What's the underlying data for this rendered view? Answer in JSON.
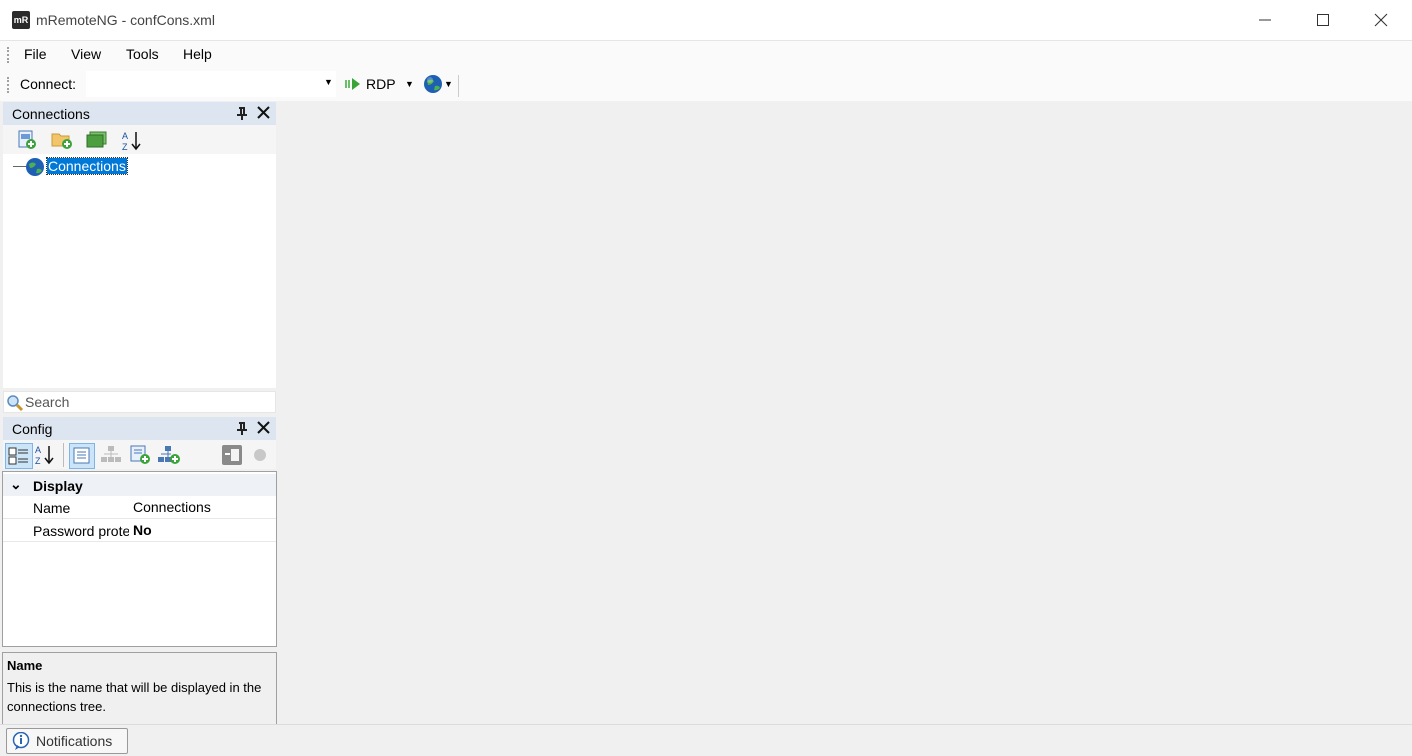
{
  "window": {
    "logo_text": "mR",
    "title": "mRemoteNG - confCons.xml",
    "minimize_glyph": "—",
    "maximize_glyph": "☐",
    "close_glyph": "✕"
  },
  "menu": {
    "items": [
      {
        "label": "File"
      },
      {
        "label": "View"
      },
      {
        "label": "Tools"
      },
      {
        "label": "Help"
      }
    ]
  },
  "toolbar": {
    "connect_label": "Connect:",
    "connect_value": "",
    "protocol": "RDP",
    "dropdown_glyph": "▼"
  },
  "connections_panel": {
    "title": "Connections",
    "pin_glyph": "ᚹ",
    "close_glyph": "✕",
    "sort_glyph": "A↓Z",
    "tree": [
      {
        "label": "Connections",
        "selected": true
      }
    ],
    "search_placeholder": "Search"
  },
  "config_panel": {
    "title": "Config",
    "pin_glyph": "ᚹ",
    "close_glyph": "✕",
    "category": {
      "label": "Display",
      "expander": "⌄"
    },
    "properties": [
      {
        "name": "Name",
        "value": "Connections",
        "bold": false
      },
      {
        "name": "Password protect",
        "value": "No",
        "bold": true
      }
    ],
    "description": {
      "title": "Name",
      "text": "This is the name that will be displayed in the connections tree."
    }
  },
  "statusbar": {
    "notifications_label": "Notifications"
  },
  "colors": {
    "selection": "#0078d7",
    "panel_header": "#dde6f0",
    "workspace": "#f0f0f0"
  }
}
